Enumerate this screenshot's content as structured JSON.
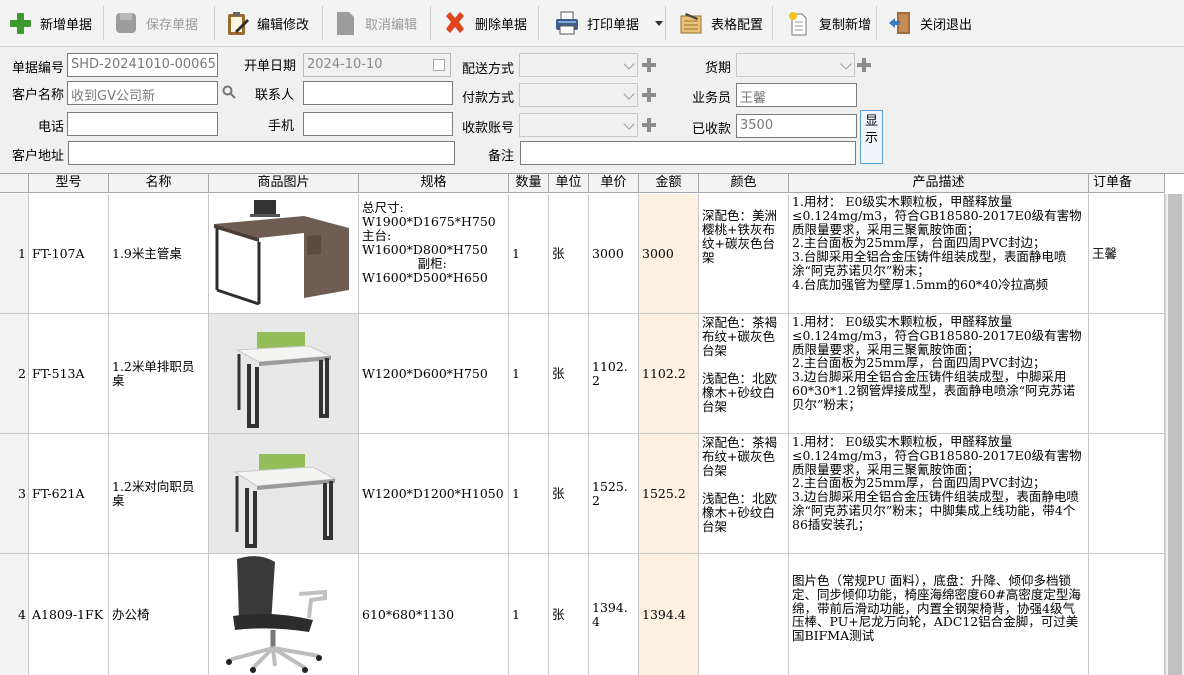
{
  "toolbar": {
    "add": "新增单据",
    "save": "保存单据",
    "edit": "编辑修改",
    "cancel": "取消编辑",
    "delete": "删除单据",
    "print": "打印单据",
    "table_config": "表格配置",
    "copy_new": "复制新增",
    "close": "关闭退出"
  },
  "form": {
    "doc_no_label": "单据编号",
    "doc_no": "SHD-20241010-00065",
    "date_label": "开单日期",
    "date": "2024-10-10",
    "delivery_label": "配送方式",
    "delivery": "",
    "currency_label": "货期",
    "currency": "",
    "customer_label": "客户名称",
    "customer": "收到GV公司新",
    "contact_label": "联系人",
    "contact": "",
    "payment_label": "付款方式",
    "payment": "",
    "salesman_label": "业务员",
    "salesman": "王馨",
    "phone_label": "电话",
    "phone": "",
    "mobile_label": "手机",
    "mobile": "",
    "account_label": "收款账号",
    "account": "",
    "received_label": "已收款",
    "received": "3500",
    "address_label": "客户地址",
    "address": "",
    "remark_label": "备注",
    "remark": "",
    "show_button": "显示"
  },
  "grid": {
    "headers": [
      "型号",
      "名称",
      "商品图片",
      "规格",
      "数量",
      "单位",
      "单价",
      "金额",
      "颜色",
      "产品描述",
      "订单备"
    ],
    "rows": [
      {
        "no": "1",
        "model": "FT-107A",
        "name": "1.9米主管桌",
        "spec": "总尺寸:\nW1900*D1675*H750\n主台:\nW1600*D800*H750\n              副柜:\nW1600*D500*H650",
        "qty": "1",
        "unit": "张",
        "price": "3000",
        "amount": "3000",
        "color": "深配色：美洲樱桃+铁灰布纹+碳灰色台架",
        "desc": "1.用材： E0级实木颗粒板，甲醛释放量≤0.124mg/m3，符合GB18580-2017E0级有害物质限量要求，采用三聚氰胺饰面；\n2.主台面板为25mm厚，台面四周PVC封边；\n3.台脚采用全铝合金压铸件组装成型，表面静电喷涂“阿克苏诺贝尔”粉末；\n4.台底加强管为壁厚1.5mm的60*40冷拉高频",
        "order_note": "王馨"
      },
      {
        "no": "2",
        "model": "FT-513A",
        "name": "1.2米单排职员桌",
        "spec": "W1200*D600*H750",
        "qty": "1",
        "unit": "张",
        "price": "1102.2",
        "amount": "1102.2",
        "color": "深配色：茶褐布纹+碳灰色台架\n\n浅配色：北欧橡木+砂纹白台架",
        "desc": "1.用材： E0级实木颗粒板，甲醛释放量≤0.124mg/m3，符合GB18580-2017E0级有害物质限量要求，采用三聚氰胺饰面；\n2.主台面板为25mm厚，台面四周PVC封边；\n3.边台脚采用全铝合金压铸件组装成型，中脚采用60*30*1.2钢管焊接成型，表面静电喷涂“阿克苏诺贝尔”粉末；",
        "order_note": ""
      },
      {
        "no": "3",
        "model": "FT-621A",
        "name": "1.2米对向职员桌",
        "spec": "W1200*D1200*H1050",
        "qty": "1",
        "unit": "张",
        "price": "1525.2",
        "amount": "1525.2",
        "color": "深配色：茶褐布纹+碳灰色台架\n\n浅配色：北欧橡木+砂纹白台架",
        "desc": "1.用材： E0级实木颗粒板，甲醛释放量≤0.124mg/m3，符合GB18580-2017E0级有害物质限量要求，采用三聚氰胺饰面；\n2.主台面板为25mm厚，台面四周PVC封边；\n3.边台脚采用全铝合金压铸件组装成型，表面静电喷涂“阿克苏诺贝尔”粉末；中脚集成上线功能，带4个86插安装孔；",
        "order_note": ""
      },
      {
        "no": "4",
        "model": "A1809-1FK",
        "name": "办公椅",
        "spec": "610*680*1130",
        "qty": "1",
        "unit": "张",
        "price": "1394.4",
        "amount": "1394.4",
        "color": "",
        "desc": "图片色（常规PU 面料），底盘：升降、倾仰多档锁定、同步倾仰功能，椅座海绵密度60#高密度定型海绵，带前后滑动功能，内置全钢架椅背，协强4级气压棒、PU+尼龙万向轮，ADC12铝合金脚，可过美国BIFMA测试",
        "order_note": ""
      }
    ]
  }
}
